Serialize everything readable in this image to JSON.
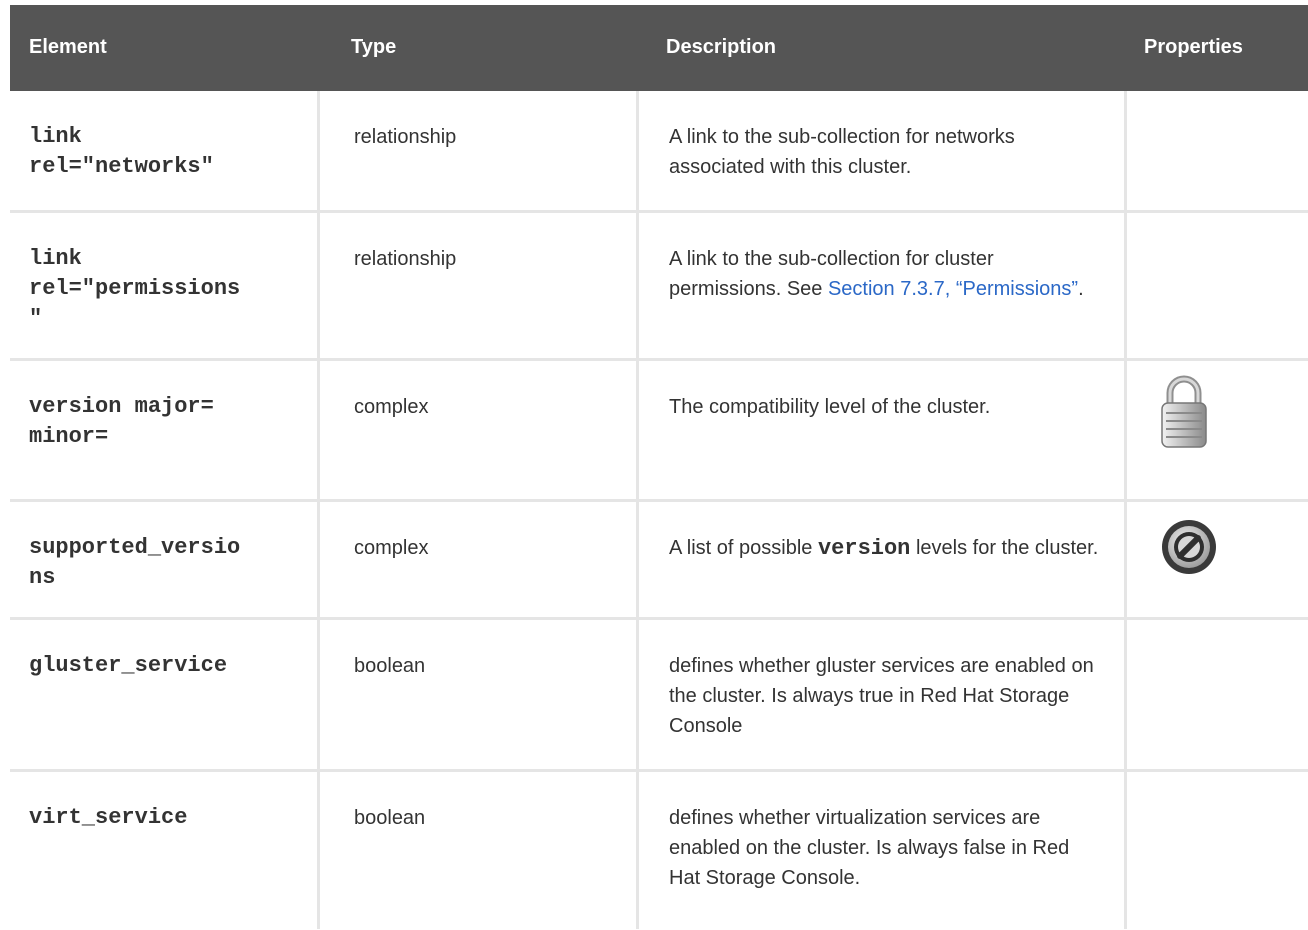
{
  "headers": {
    "element": "Element",
    "type": "Type",
    "description": "Description",
    "properties": "Properties"
  },
  "rows": [
    {
      "element_l1": "link",
      "element_l2": "rel=\"networks\"",
      "type": "relationship",
      "description": "A link to the sub-collection for networks associated with this cluster."
    },
    {
      "element_l1": "link",
      "element_l2": "rel=\"permissions",
      "element_l3": "\"",
      "type": "relationship",
      "description_prefix": "A link to the sub-collection for cluster permissions. See ",
      "description_link": "Section 7.3.7, “Permissions”",
      "description_suffix": "."
    },
    {
      "element_l1": "version major=",
      "element_l2": "minor=",
      "type": "complex",
      "description": "The compatibility level of the cluster.",
      "property_icon": "lock-icon"
    },
    {
      "element_l1": "supported_versio",
      "element_l2": "ns",
      "type": "complex",
      "description_prefix": "A list of possible ",
      "description_code": "version",
      "description_suffix": " levels for the cluster.",
      "property_icon": "no-entry-icon"
    },
    {
      "element_l1": "gluster_service",
      "type": "boolean",
      "description": "defines whether gluster services are enabled on the cluster. Is always true in Red Hat Storage Console"
    },
    {
      "element_l1": "virt_service",
      "type": "boolean",
      "description": "defines whether virtualization services are enabled on the cluster. Is always false in Red Hat Storage Console."
    }
  ]
}
